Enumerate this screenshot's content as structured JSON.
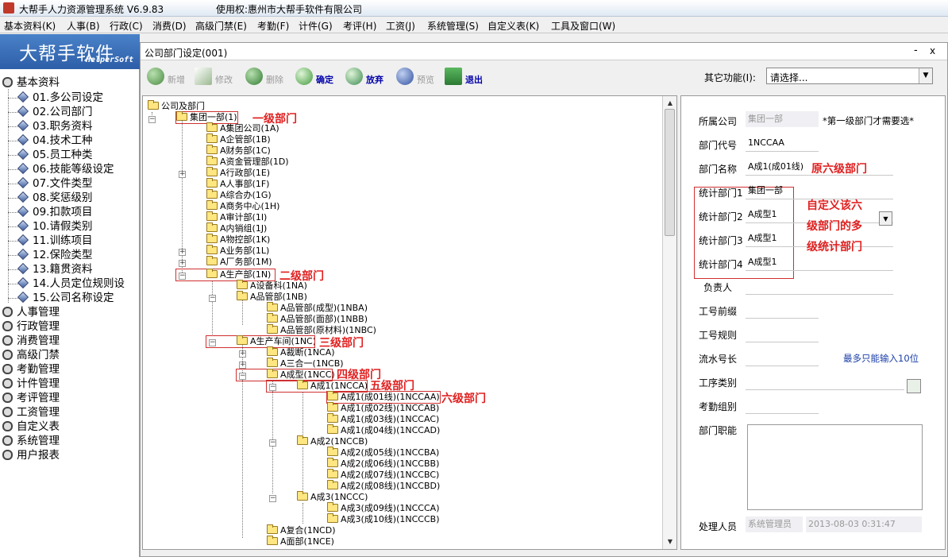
{
  "window": {
    "title": "大帮手人力资源管理系统 V6.9.83",
    "copyright": "使用权:惠州市大帮手软件有限公司"
  },
  "menu": [
    "基本资料(K)",
    "人事(B)",
    "行政(C)",
    "消费(D)",
    "高级门禁(E)",
    "考勤(F)",
    "计件(G)",
    "考评(H)",
    "工资(J)",
    "系统管理(S)",
    "自定义表(K)",
    "工具及窗口(W)"
  ],
  "logo": {
    "brand": "大帮手软件",
    "brand_en": "HelperSoft"
  },
  "nav": {
    "root": "基本资料",
    "sub": [
      "01.多公司设定",
      "02.公司部门",
      "03.职务资料",
      "04.技术工种",
      "05.员工种类",
      "06.技能等级设定",
      "07.文件类型",
      "08.奖惩级别",
      "09.扣款项目",
      "10.请假类别",
      "11.训练项目",
      "12.保险类型",
      "13.籍贯资料",
      "14.人员定位规则设",
      "15.公司名称设定"
    ],
    "modules": [
      "人事管理",
      "行政管理",
      "消费管理",
      "高级门禁",
      "考勤管理",
      "计件管理",
      "考评管理",
      "工资管理",
      "自定义表",
      "系统管理",
      "用户报表"
    ]
  },
  "child": {
    "title": "公司部门设定(001)",
    "min": "-",
    "close": "x"
  },
  "toolbar": {
    "buttons": [
      "新增",
      "修改",
      "删除",
      "确定",
      "放弃",
      "预览",
      "退出"
    ],
    "other_label": "其它功能(I):",
    "other_value": "请选择..."
  },
  "tree": [
    "公司及部门",
    "集团一部(1)",
    "A集团公司(1A)",
    "A企管部(1B)",
    "A财务部(1C)",
    "A资金管理部(1D)",
    "A行政部(1E)",
    "A人事部(1F)",
    "A综合办(1G)",
    "A商务中心(1H)",
    "A审计部(1I)",
    "A内销组(1J)",
    "A物控部(1K)",
    "A业务部(1L)",
    "A厂务部(1M)",
    "A生产部(1N)",
    "A设备科(1NA)",
    "A品管部(1NB)",
    "A品管部(成型)(1NBA)",
    "A品管部(面部)(1NBB)",
    "A品管部(原材料)(1NBC)",
    "A生产车间(1NC)",
    "A裁断(1NCA)",
    "A三合一(1NCB)",
    "A成型(1NCC)",
    "A成1(1NCCA)",
    "A成1(成01线)(1NCCAA)",
    "A成1(成02线)(1NCCAB)",
    "A成1(成03线)(1NCCAC)",
    "A成1(成04线)(1NCCAD)",
    "A成2(1NCCB)",
    "A成2(成05线)(1NCCBA)",
    "A成2(成06线)(1NCCBB)",
    "A成2(成07线)(1NCCBC)",
    "A成2(成08线)(1NCCBD)",
    "A成3(1NCCC)",
    "A成3(成09线)(1NCCCA)",
    "A成3(成10线)(1NCCCB)",
    "A复合(1NCD)",
    "A面部(1NCE)"
  ],
  "annotations": {
    "level1": "一级部门",
    "level2": "二级部门",
    "level3": "三级部门",
    "level4": "四级部门",
    "level5": "五级部门",
    "level6": "六级部门",
    "orig6": "原六级部门",
    "custom_l1": "自定义该六",
    "custom_l2": "级部门的多",
    "custom_l3": "级统计部门"
  },
  "form": {
    "company_label": "所属公司",
    "company_value": "集团一部",
    "company_note": "*第一级部门才需要选*",
    "code_label": "部门代号",
    "code_value": "1NCCAA",
    "name_label": "部门名称",
    "name_value": "A成1(成01线)",
    "stat1_label": "统计部门1",
    "stat1_value": "集团一部",
    "stat2_label": "统计部门2",
    "stat2_value": "A成型1",
    "stat3_label": "统计部门3",
    "stat3_value": "A成型1",
    "stat4_label": "统计部门4",
    "stat4_value": "A成型1",
    "owner_label": "负责人",
    "prefix_label": "工号前缀",
    "rule_label": "工号规则",
    "seq_label": "流水号长",
    "seq_note": "最多只能输入10位",
    "proc_label": "工序类别",
    "group_label": "考勤组别",
    "duty_label": "部门职能",
    "handler_label": "处理人员",
    "handler_value": "系统管理员",
    "handler_time": "2013-08-03 0:31:47"
  },
  "colors": {
    "annotation": "#e02020",
    "link_blue": "#1a3ea8",
    "toolbar_active": "#0000aa"
  }
}
